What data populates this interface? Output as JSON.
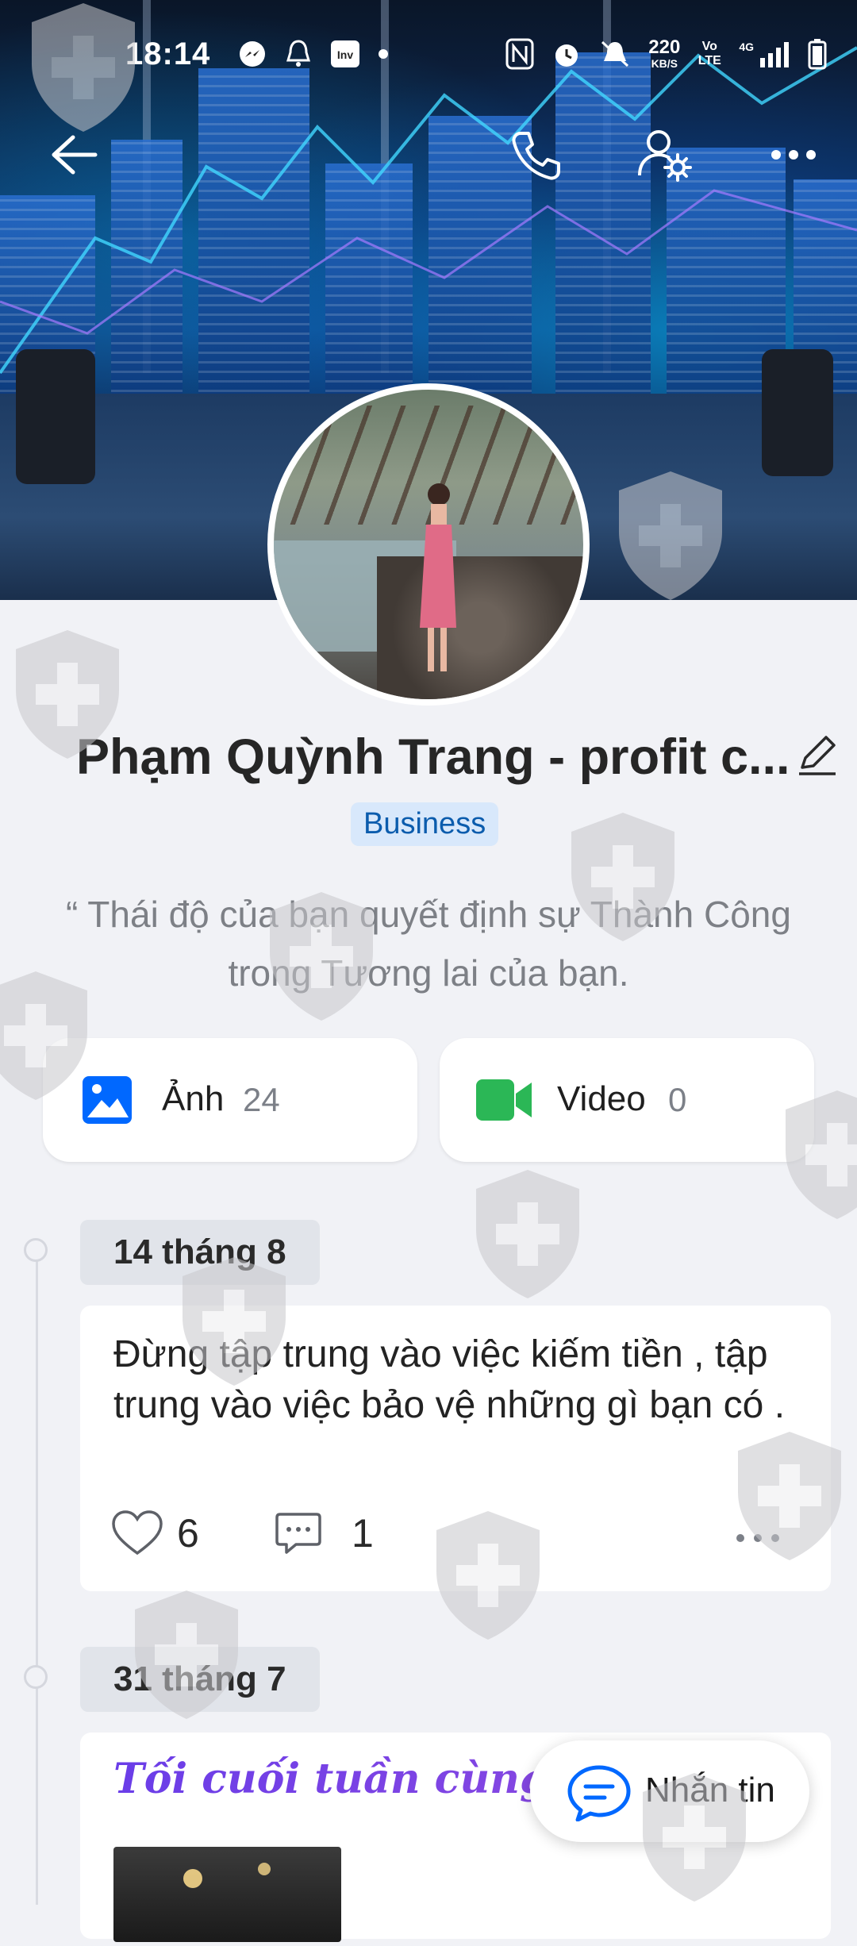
{
  "status_bar": {
    "time": "18:14",
    "net_speed_value": "220",
    "net_speed_unit": "KB/S",
    "volte": "Vo LTE",
    "network": "4G"
  },
  "profile": {
    "name": "Phạm Quỳnh Trang - profit c...",
    "badge": "Business",
    "bio": "“ Thái độ của bạn quyết định sự Thành Công trong Tương lai của bạn."
  },
  "media": {
    "photos_label": "Ảnh",
    "photos_count": "24",
    "videos_label": "Video",
    "videos_count": "0"
  },
  "timeline": [
    {
      "date": "14 tháng 8",
      "text": "Đừng tập trung vào việc kiếm tiền , tập trung vào việc bảo vệ những gì bạn có .",
      "likes": "6",
      "comments": "1"
    },
    {
      "date": "31 tháng 7",
      "title": "Tối cuối tuần cùng mọi n"
    }
  ],
  "message_button": "Nhắn tin",
  "colors": {
    "accent_blue": "#0068ff",
    "video_green": "#2bb756",
    "badge_bg": "#d8e8fb"
  }
}
